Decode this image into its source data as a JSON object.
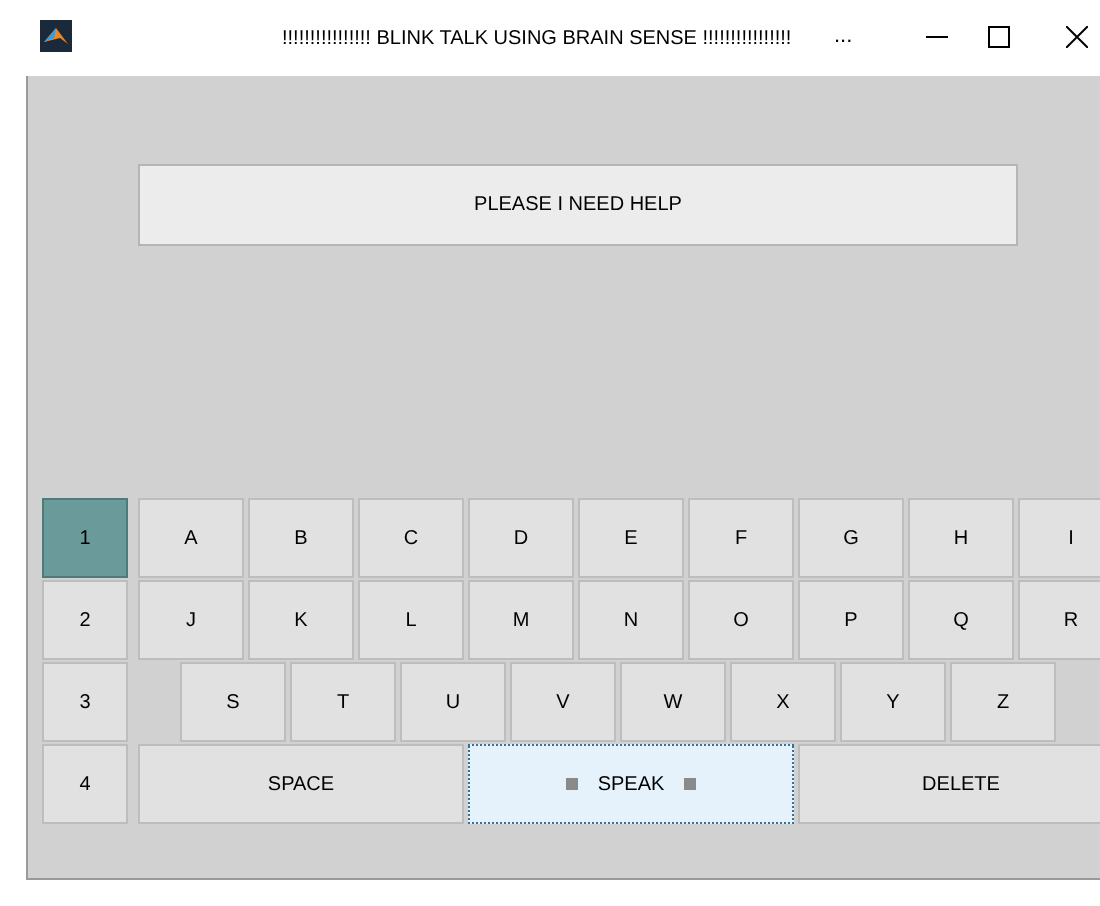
{
  "window": {
    "title": "!!!!!!!!!!!!!!!! BLINK TALK USING BRAIN SENSE !!!!!!!!!!!!!!!!",
    "more": "..."
  },
  "display": {
    "text": "PLEASE I NEED HELP"
  },
  "rows": [
    {
      "label": "1",
      "selected": true,
      "keys": [
        {
          "label": "A"
        },
        {
          "label": "B"
        },
        {
          "label": "C"
        },
        {
          "label": "D"
        },
        {
          "label": "E"
        },
        {
          "label": "F"
        },
        {
          "label": "G"
        },
        {
          "label": "H"
        },
        {
          "label": "I"
        }
      ]
    },
    {
      "label": "2",
      "selected": false,
      "keys": [
        {
          "label": "J"
        },
        {
          "label": "K"
        },
        {
          "label": "L"
        },
        {
          "label": "M"
        },
        {
          "label": "N"
        },
        {
          "label": "O"
        },
        {
          "label": "P"
        },
        {
          "label": "Q"
        },
        {
          "label": "R"
        }
      ]
    },
    {
      "label": "3",
      "selected": false,
      "keys": [
        {
          "label": "S"
        },
        {
          "label": "T"
        },
        {
          "label": "U"
        },
        {
          "label": "V"
        },
        {
          "label": "W"
        },
        {
          "label": "X"
        },
        {
          "label": "Y"
        },
        {
          "label": "Z"
        }
      ]
    },
    {
      "label": "4",
      "selected": false,
      "keys": [
        {
          "label": "SPACE",
          "focused": false
        },
        {
          "label": "SPEAK",
          "focused": true
        },
        {
          "label": "DELETE",
          "focused": false
        }
      ]
    }
  ]
}
